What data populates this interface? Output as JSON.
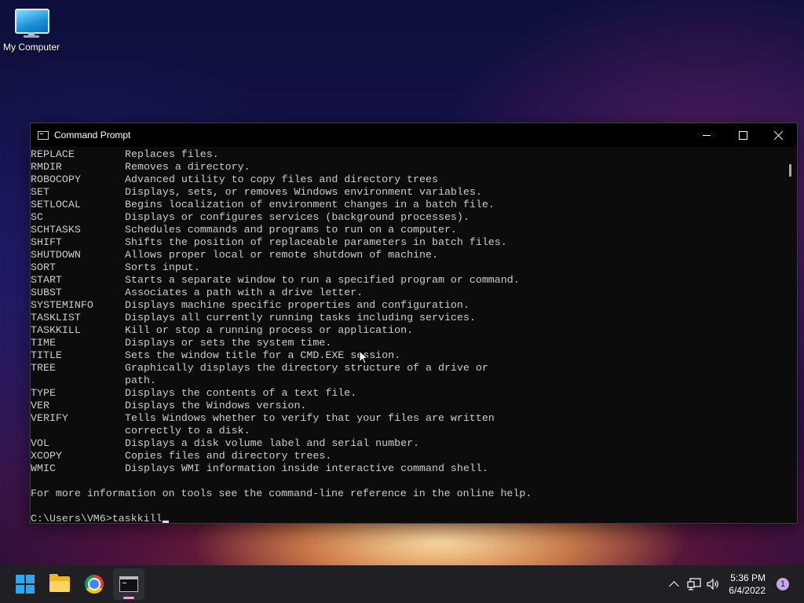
{
  "desktop": {
    "icons": [
      {
        "label": "My Computer",
        "icon": "monitor-icon"
      }
    ]
  },
  "window": {
    "title": "Command Prompt",
    "icon": "cmd-icon",
    "controls": {
      "minimize": "minimize-icon",
      "maximize": "maximize-icon",
      "close": "close-icon"
    }
  },
  "console": {
    "rows": [
      {
        "cmd": "REPLACE",
        "desc": "Replaces files."
      },
      {
        "cmd": "RMDIR",
        "desc": "Removes a directory."
      },
      {
        "cmd": "ROBOCOPY",
        "desc": "Advanced utility to copy files and directory trees"
      },
      {
        "cmd": "SET",
        "desc": "Displays, sets, or removes Windows environment variables."
      },
      {
        "cmd": "SETLOCAL",
        "desc": "Begins localization of environment changes in a batch file."
      },
      {
        "cmd": "SC",
        "desc": "Displays or configures services (background processes)."
      },
      {
        "cmd": "SCHTASKS",
        "desc": "Schedules commands and programs to run on a computer."
      },
      {
        "cmd": "SHIFT",
        "desc": "Shifts the position of replaceable parameters in batch files."
      },
      {
        "cmd": "SHUTDOWN",
        "desc": "Allows proper local or remote shutdown of machine."
      },
      {
        "cmd": "SORT",
        "desc": "Sorts input."
      },
      {
        "cmd": "START",
        "desc": "Starts a separate window to run a specified program or command."
      },
      {
        "cmd": "SUBST",
        "desc": "Associates a path with a drive letter."
      },
      {
        "cmd": "SYSTEMINFO",
        "desc": "Displays machine specific properties and configuration."
      },
      {
        "cmd": "TASKLIST",
        "desc": "Displays all currently running tasks including services."
      },
      {
        "cmd": "TASKKILL",
        "desc": "Kill or stop a running process or application."
      },
      {
        "cmd": "TIME",
        "desc": "Displays or sets the system time."
      },
      {
        "cmd": "TITLE",
        "desc": "Sets the window title for a CMD.EXE session."
      },
      {
        "cmd": "TREE",
        "desc": "Graphically displays the directory structure of a drive or"
      },
      {
        "cmd": "",
        "desc": "path."
      },
      {
        "cmd": "TYPE",
        "desc": "Displays the contents of a text file."
      },
      {
        "cmd": "VER",
        "desc": "Displays the Windows version."
      },
      {
        "cmd": "VERIFY",
        "desc": "Tells Windows whether to verify that your files are written"
      },
      {
        "cmd": "",
        "desc": "correctly to a disk."
      },
      {
        "cmd": "VOL",
        "desc": "Displays a disk volume label and serial number."
      },
      {
        "cmd": "XCOPY",
        "desc": "Copies files and directory trees."
      },
      {
        "cmd": "WMIC",
        "desc": "Displays WMI information inside interactive command shell."
      }
    ],
    "footer": "For more information on tools see the command-line reference in the online help.",
    "prompt": "C:\\Users\\VM6>",
    "input": "taskkill"
  },
  "taskbar": {
    "apps": [
      {
        "name": "start-button",
        "icon": "windows-logo-icon"
      },
      {
        "name": "file-explorer-button",
        "icon": "folder-icon"
      },
      {
        "name": "chrome-button",
        "icon": "chrome-icon"
      },
      {
        "name": "command-prompt-taskbar-button",
        "icon": "terminal-icon",
        "active": true
      }
    ],
    "tray": {
      "icons": [
        "chevron-up-icon",
        "network-icon",
        "volume-icon"
      ],
      "time": "5:36 PM",
      "date": "6/4/2022",
      "notification_count": "1"
    }
  },
  "colors": {
    "console_bg": "#0c0c0c",
    "console_fg": "#cccccc",
    "taskbar_bg": "#1f1f24",
    "start_blue": "#2ea7f2"
  }
}
